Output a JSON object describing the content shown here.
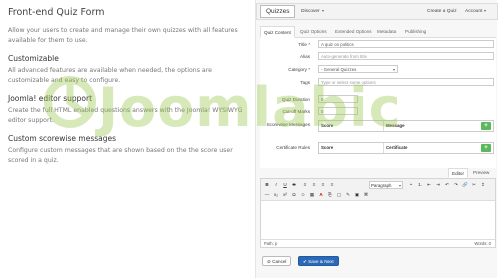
{
  "left": {
    "title": "Front-end Quiz Form",
    "intro": "Allow your users to create and manage their own quizzes with all features available for them to use.",
    "sections": [
      {
        "heading": "Customizable",
        "text": "All advanced features are available when needed, the options are customizable and easy to configure."
      },
      {
        "heading": "Joomla! editor support",
        "text": "Create the full HTML enabled questions answers with the Joomla! WYSIWYG editor support."
      },
      {
        "heading": "Custom scorewise messages",
        "text": "Configure custom messages that are shown based on the the score user scored in a quiz."
      }
    ]
  },
  "watermark": {
    "text": "Joomlabic",
    "color": "#9bc84a"
  },
  "navbar": {
    "brand": "Quizzes",
    "discover": "Discover",
    "create": "Create a Quiz",
    "account": "Account"
  },
  "tabs": [
    "Quiz Content",
    "Quiz Options",
    "Extended Options",
    "Metadata",
    "Publishing"
  ],
  "form": {
    "title_label": "Title *",
    "title_value": "A quiz on politics",
    "alias_label": "Alias",
    "alias_placeholder": "Auto-generate from title",
    "category_label": "Category *",
    "category_value": "- General Quizzes",
    "tags_label": "Tags",
    "tags_placeholder": "Type or select some options",
    "duration_label": "Quiz Duration",
    "duration_value": "0",
    "cutoff_label": "Cut-off Marks",
    "cutoff_value": "0",
    "scorewise_label": "Scorewise Messages",
    "scorewise_col1": "Score",
    "scorewise_col2": "Message",
    "certificate_label": "Certificate Rules",
    "certificate_col1": "Score",
    "certificate_col2": "Certificate",
    "add_symbol": "+"
  },
  "editor": {
    "tab_editor": "Editor",
    "tab_preview": "Preview",
    "toolbar_row1": [
      "B",
      "I",
      "U",
      "S",
      "≡",
      "≡",
      "≡",
      "≡",
      "•",
      "1.",
      "⇤",
      "⇥",
      "↶",
      "↷",
      "🔗",
      "✂",
      "↥"
    ],
    "paragraph": "Paragraph",
    "toolbar_row2": [
      "—",
      "x₂",
      "x²",
      "Ω",
      "☺",
      "▦",
      "A",
      "⎘",
      "▢",
      "✎",
      "▣",
      "⌘"
    ],
    "path": "Path: p",
    "words": "Words: 0"
  },
  "buttons": {
    "cancel": "Cancel",
    "save": "Save & Next"
  },
  "colors": {
    "accent": "#2a69b8",
    "success": "#5cb85c",
    "panel_bg": "#f7f7f7"
  }
}
